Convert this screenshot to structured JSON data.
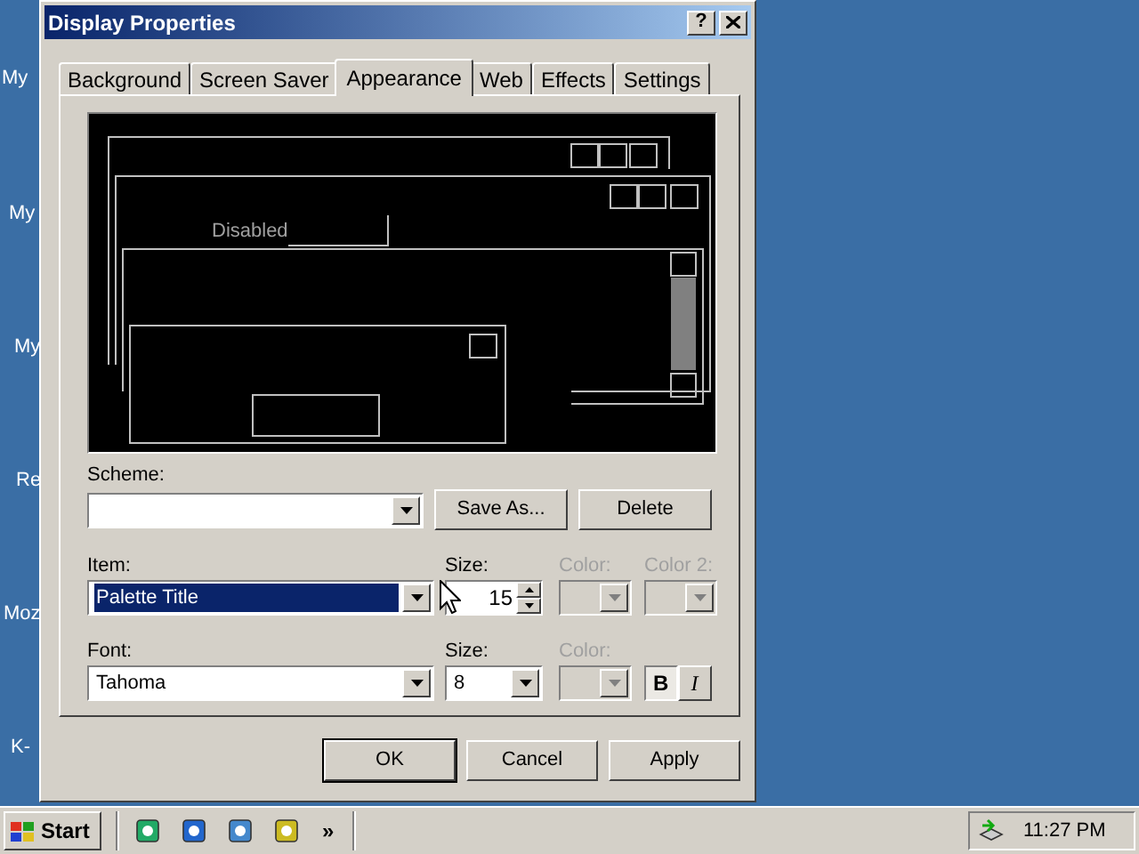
{
  "desktop_icons": [
    {
      "label": "My"
    },
    {
      "label": "My"
    },
    {
      "label": "My"
    },
    {
      "label": "Re"
    },
    {
      "label": "Moz"
    },
    {
      "label": "K-"
    }
  ],
  "window": {
    "title": "Display Properties",
    "help": "?"
  },
  "tabs": [
    {
      "label": "Background",
      "selected": false
    },
    {
      "label": "Screen Saver",
      "selected": false
    },
    {
      "label": "Appearance",
      "selected": true
    },
    {
      "label": "Web",
      "selected": false
    },
    {
      "label": "Effects",
      "selected": false
    },
    {
      "label": "Settings",
      "selected": false
    }
  ],
  "preview": {
    "disabled_label": "Disabled"
  },
  "scheme": {
    "label": "Scheme:",
    "save_as": "Save As...",
    "delete": "Delete"
  },
  "item": {
    "label": "Item:",
    "value": "Palette Title",
    "focused": true,
    "size_label": "Size:",
    "size": "15",
    "color_label": "Color:",
    "color_disabled": true,
    "color2_label": "Color 2:",
    "color2_disabled": true
  },
  "font": {
    "label": "Font:",
    "value": "Tahoma",
    "size_label": "Size:",
    "size": "8",
    "color_label": "Color:",
    "color_disabled": true,
    "bold": {
      "label": "B",
      "pressed": true
    },
    "italic": {
      "label": "I",
      "pressed": false
    }
  },
  "dialog_buttons": [
    {
      "label": "OK",
      "default": true
    },
    {
      "label": "Cancel",
      "default": false
    },
    {
      "label": "Apply",
      "default": false
    }
  ],
  "taskbar": {
    "start": "Start",
    "more": "»",
    "clock": "11:27 PM"
  }
}
